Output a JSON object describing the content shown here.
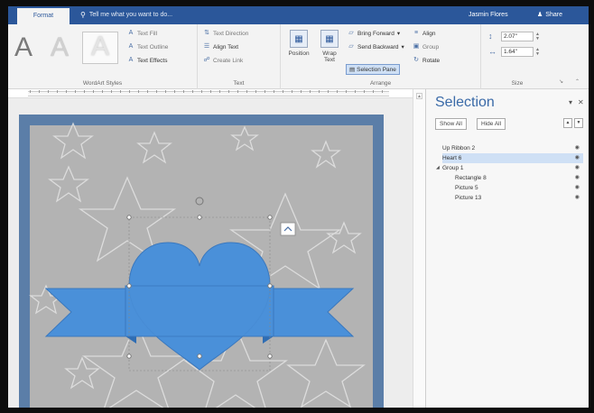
{
  "titlebar": {
    "tab": "Format",
    "tell_me": "Tell me what you want to do...",
    "user": "Jasmin Flores",
    "share": "Share"
  },
  "ribbon": {
    "wordart": {
      "letters": [
        "A",
        "A",
        "A"
      ],
      "text_fill": "Text Fill",
      "text_outline": "Text Outline",
      "text_effects": "Text Effects",
      "group_label": "WordArt Styles"
    },
    "text": {
      "text_direction": "Text Direction",
      "align_text": "Align Text",
      "create_link": "Create Link",
      "group_label": "Text"
    },
    "arrange": {
      "position": "Position",
      "wrap_text_1": "Wrap",
      "wrap_text_2": "Text",
      "bring_forward": "Bring Forward",
      "send_backward": "Send Backward",
      "selection_pane": "Selection Pane",
      "align": "Align",
      "group": "Group",
      "rotate": "Rotate",
      "group_label": "Arrange"
    },
    "size": {
      "height": "2.07\"",
      "width": "1.64\"",
      "group_label": "Size"
    }
  },
  "selection_pane": {
    "title": "Selection",
    "show_all": "Show All",
    "hide_all": "Hide All",
    "items": [
      {
        "name": "Up Ribbon 2",
        "level": 0,
        "selected": false
      },
      {
        "name": "Heart 6",
        "level": 0,
        "selected": true
      },
      {
        "name": "Group 1",
        "level": 0,
        "selected": false
      },
      {
        "name": "Rectangle 8",
        "level": 1,
        "selected": false
      },
      {
        "name": "Picture 5",
        "level": 1,
        "selected": false
      },
      {
        "name": "Picture 13",
        "level": 1,
        "selected": false
      }
    ]
  },
  "colors": {
    "accent": "#2b579a",
    "heart": "#4a90d9",
    "ribbon_shape": "#4a90d9",
    "border": "#5b7ea8"
  }
}
